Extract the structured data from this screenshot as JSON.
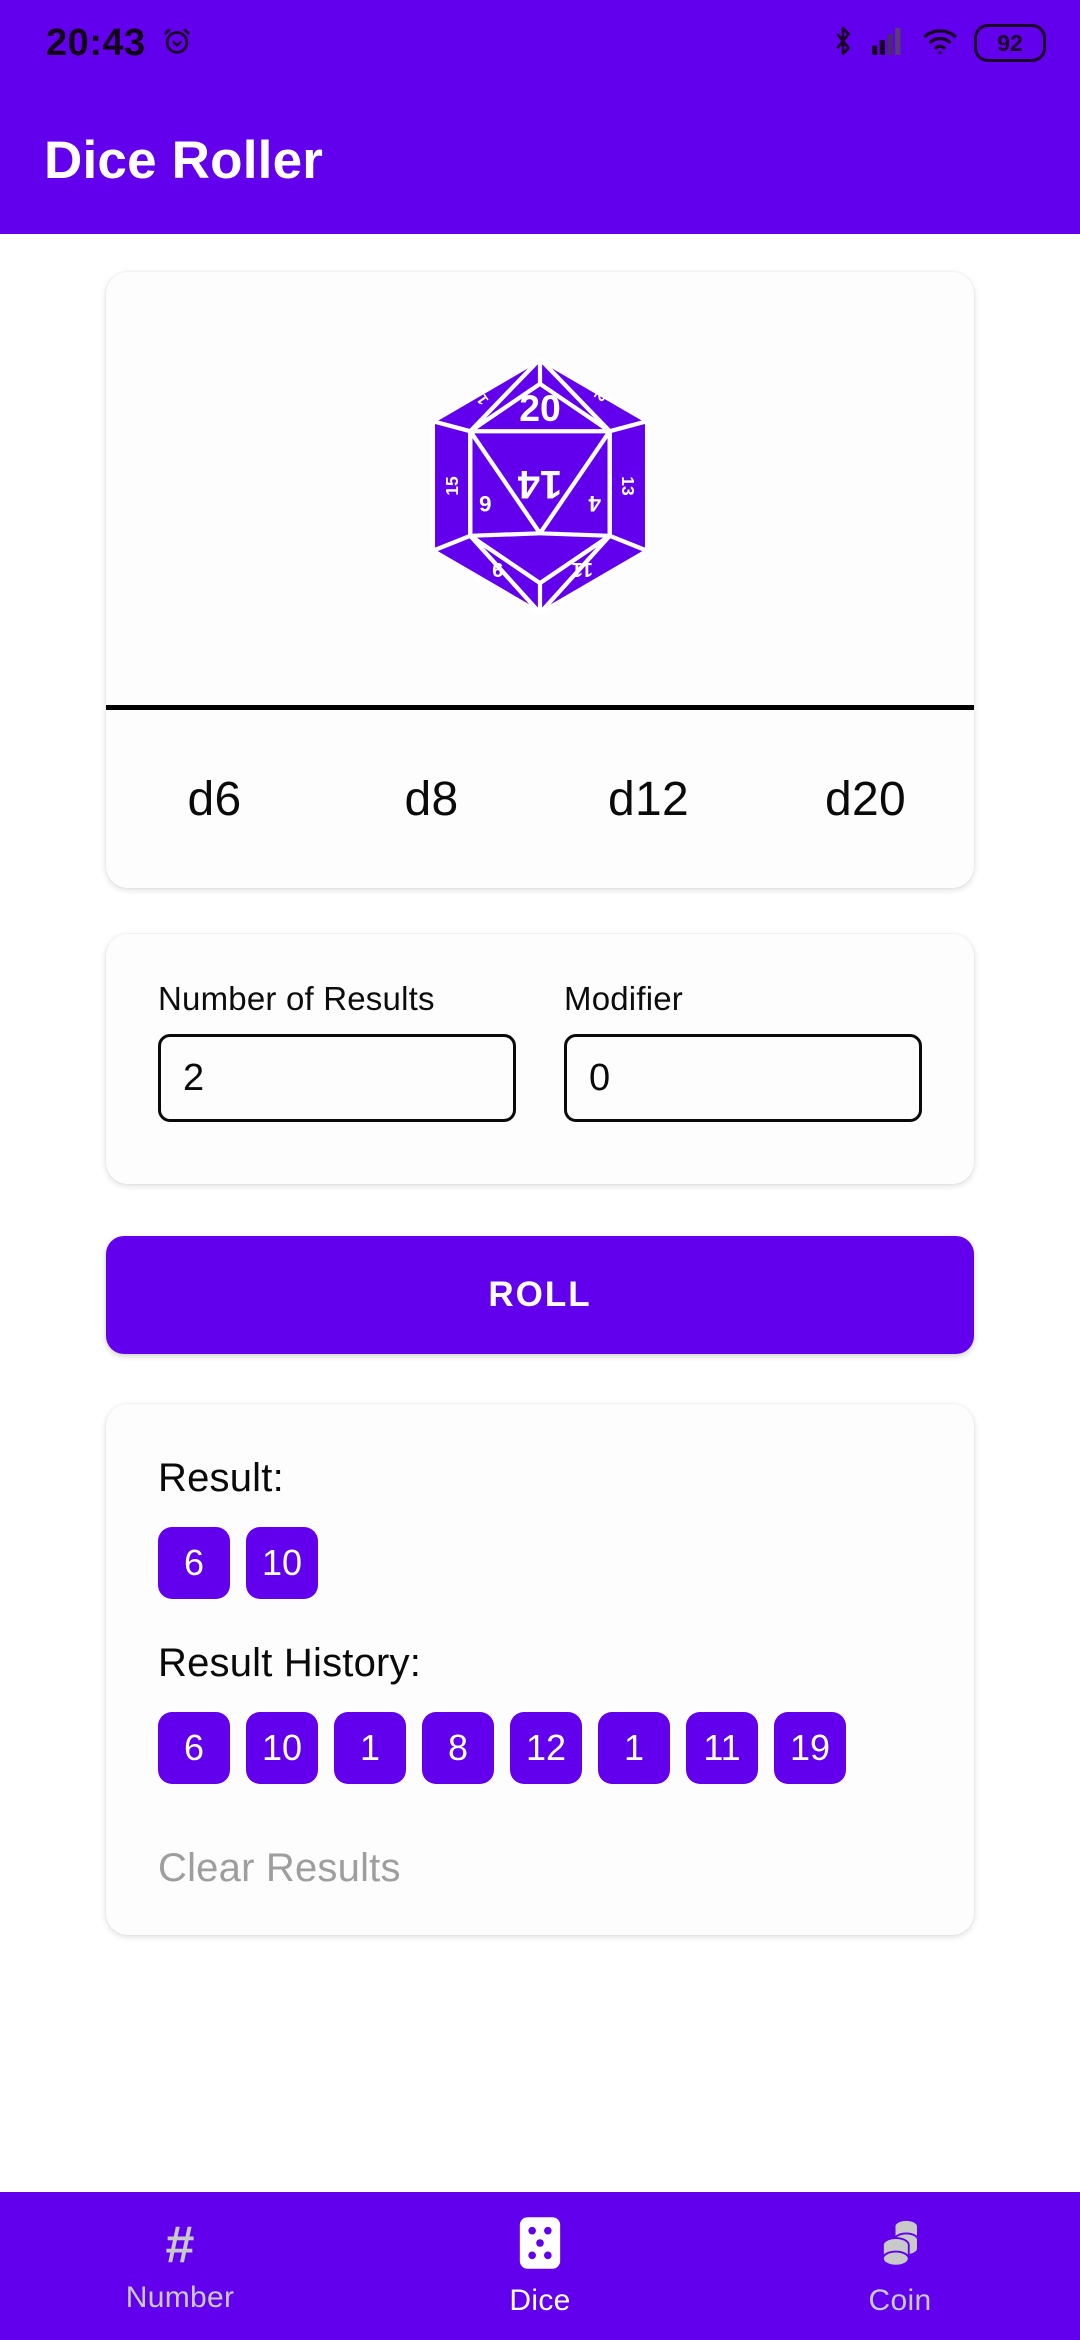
{
  "statusbar": {
    "time": "20:43",
    "alarm_icon": "alarm-clock-icon",
    "bluetooth_icon": "bluetooth-icon",
    "signal_icon": "cellular-signal-icon",
    "wifi_icon": "wifi-icon",
    "battery_level": "92"
  },
  "appbar": {
    "title": "Dice Roller",
    "background_color": "#6200EE",
    "text_color": "#FFFFFF"
  },
  "dice_selector": {
    "image_icon": "d20-icosahedron-icon",
    "die_face_numbers": [
      "20",
      "14",
      "13",
      "11",
      "9",
      "6",
      "4"
    ],
    "tabs": [
      {
        "label": "d6"
      },
      {
        "label": "d8"
      },
      {
        "label": "d12"
      },
      {
        "label": "d20"
      }
    ],
    "selected": "d20"
  },
  "inputs": {
    "number_of_results": {
      "label": "Number of Results",
      "value": "2",
      "placeholder": "2"
    },
    "modifier": {
      "label": "Modifier",
      "value": "0",
      "placeholder": "0"
    }
  },
  "roll_button": {
    "label": "ROLL",
    "color": "#6200EE"
  },
  "results": {
    "result_label": "Result:",
    "result_values": [
      "6",
      "10"
    ],
    "history_label": "Result History:",
    "history_values": [
      "6",
      "10",
      "1",
      "8",
      "12",
      "1",
      "11",
      "19"
    ],
    "clear_label": "Clear Results",
    "clear_color": "#9E9E9E",
    "chip_color": "#6200EE"
  },
  "bottom_nav": {
    "items": [
      {
        "label": "Number",
        "icon": "hash-icon",
        "active": false
      },
      {
        "label": "Dice",
        "icon": "dice-five-icon",
        "active": true
      },
      {
        "label": "Coin",
        "icon": "coin-stack-icon",
        "active": false
      }
    ],
    "active_color": "#FFFFFF",
    "inactive_color": "#C9C9C9"
  }
}
